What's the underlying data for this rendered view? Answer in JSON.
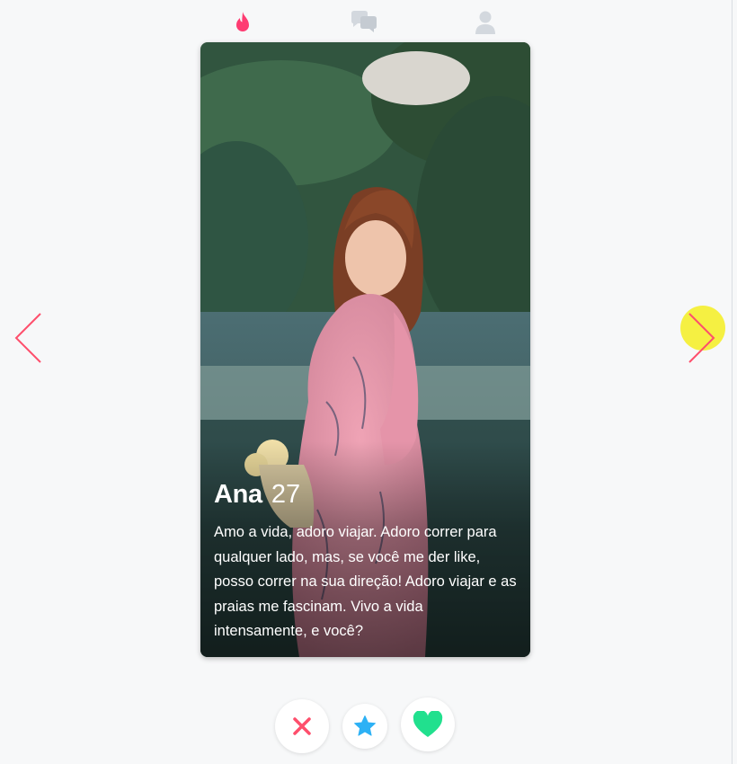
{
  "nav": {
    "items": [
      {
        "icon": "flame-icon",
        "active": true
      },
      {
        "icon": "chat-bubbles-icon",
        "active": false
      },
      {
        "icon": "profile-icon",
        "active": false
      }
    ]
  },
  "profile": {
    "name": "Ana",
    "age": "27",
    "bio": "Amo a vida, adoro viajar. Adoro correr para qualquer lado, mas, se você me der like, posso correr na sua direção! Adoro viajar e as praias me fascinam. Vivo a vida intensamente, e você?"
  },
  "navigation_arrows": {
    "previous": "chevron-left-icon",
    "next": "chevron-right-icon"
  },
  "actions": [
    {
      "name": "nope",
      "icon": "x-icon"
    },
    {
      "name": "super-like",
      "icon": "star-icon"
    },
    {
      "name": "like",
      "icon": "heart-icon"
    }
  ],
  "colors": {
    "accent": "#fe3c72",
    "nope": "#fe4f6c",
    "super_like": "#2db1f5",
    "like": "#21e08e",
    "inactive_icon": "#d3d8de",
    "cursor_highlight": "#f4ef22"
  }
}
